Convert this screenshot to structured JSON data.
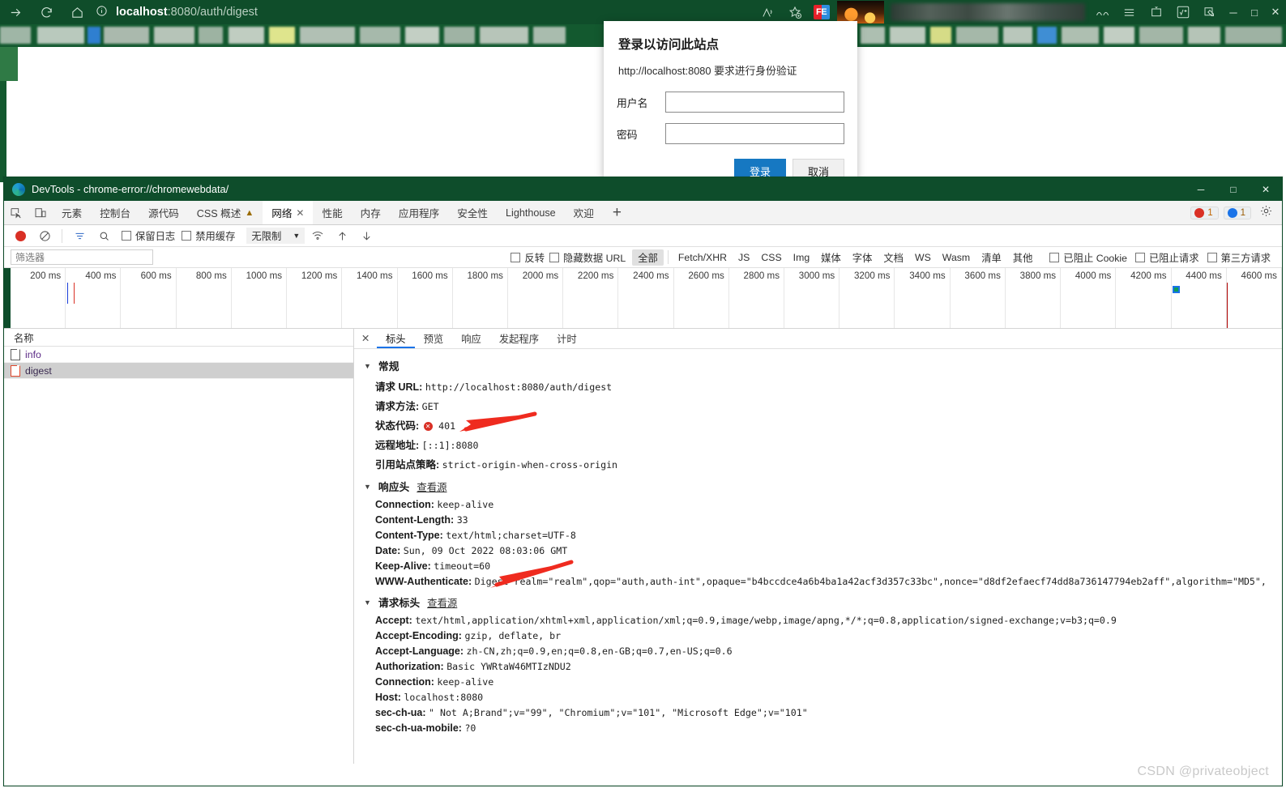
{
  "browser": {
    "url_host": "localhost",
    "url_rest": ":8080/auth/digest",
    "nav_icons": [
      "forward-arrow-icon",
      "reload-icon",
      "home-icon"
    ],
    "info_icon": "info-circle-icon",
    "toolbar_icons": [
      "read-aloud-icon",
      "add-favorite-icon",
      "fe-extension-icon",
      "avatar-icon",
      "collections-icon",
      "browser-essentials-icon",
      "split-screen-icon",
      "math-solver-icon",
      "screenshot-icon"
    ],
    "window_controls": [
      "minimize",
      "maximize",
      "close"
    ]
  },
  "login_dialog": {
    "title": "登录以访问此站点",
    "subtitle": "http://localhost:8080 要求进行身份验证",
    "username_label": "用户名",
    "username_value": "",
    "password_label": "密码",
    "password_value": "",
    "submit_label": "登录",
    "cancel_label": "取消"
  },
  "devtools": {
    "window_title": "DevTools - chrome-error://chromewebdata/",
    "logo_icon": "edge-devtools-logo-icon",
    "window_controls": {
      "minimize": "─",
      "maximize": "□",
      "close": "✕"
    },
    "dock_icons": [
      "inspect-element-icon",
      "device-toolbar-icon"
    ],
    "tabs": [
      {
        "label": "元素",
        "active": false,
        "warn": false,
        "closable": false
      },
      {
        "label": "控制台",
        "active": false,
        "warn": false,
        "closable": false
      },
      {
        "label": "源代码",
        "active": false,
        "warn": false,
        "closable": false
      },
      {
        "label": "CSS 概述",
        "active": false,
        "warn": true,
        "closable": false
      },
      {
        "label": "网络",
        "active": true,
        "warn": false,
        "closable": true
      },
      {
        "label": "性能",
        "active": false,
        "warn": false,
        "closable": false
      },
      {
        "label": "内存",
        "active": false,
        "warn": false,
        "closable": false
      },
      {
        "label": "应用程序",
        "active": false,
        "warn": false,
        "closable": false
      },
      {
        "label": "安全性",
        "active": false,
        "warn": false,
        "closable": false
      },
      {
        "label": "Lighthouse",
        "active": false,
        "warn": false,
        "closable": false
      },
      {
        "label": "欢迎",
        "active": false,
        "warn": false,
        "closable": false
      }
    ],
    "more_tabs_label": "+",
    "badges": {
      "errors": "1",
      "messages": "1"
    },
    "settings_icon": "gear-icon",
    "tab_close_glyph": "✕",
    "warn_glyph": "▲",
    "colors": {
      "accent_green": "#0e4d2b",
      "error_red": "#d93025",
      "info_blue": "#1a73e8",
      "primary_blue": "#1678c2"
    }
  },
  "network_toolbar": {
    "record_icon": "record-stop-icon",
    "clear_icon": "clear-network-icon",
    "filter_icon": "filter-icon",
    "search_icon": "search-icon",
    "preserve_log_label": "保留日志",
    "preserve_log_checked": false,
    "disable_cache_label": "禁用缓存",
    "disable_cache_checked": false,
    "throttle_value": "无限制",
    "throttle_caret": "▼",
    "wifi_icon": "network-conditions-icon",
    "import_icon": "import-har-icon",
    "export_icon": "export-har-icon"
  },
  "network_filter": {
    "placeholder": "筛选器",
    "value": "",
    "invert_label": "反转",
    "invert_checked": false,
    "hide_data_urls_label": "隐藏数据 URL",
    "hide_data_urls_checked": false,
    "types": [
      {
        "label": "全部",
        "selected": true
      },
      {
        "label": "Fetch/XHR",
        "selected": false
      },
      {
        "label": "JS",
        "selected": false
      },
      {
        "label": "CSS",
        "selected": false
      },
      {
        "label": "Img",
        "selected": false
      },
      {
        "label": "媒体",
        "selected": false
      },
      {
        "label": "字体",
        "selected": false
      },
      {
        "label": "文档",
        "selected": false
      },
      {
        "label": "WS",
        "selected": false
      },
      {
        "label": "Wasm",
        "selected": false
      },
      {
        "label": "清单",
        "selected": false
      },
      {
        "label": "其他",
        "selected": false
      }
    ],
    "blocked_cookies_label": "已阻止 Cookie",
    "blocked_cookies_checked": false,
    "blocked_requests_label": "已阻止请求",
    "blocked_requests_checked": false,
    "third_party_label": "第三方请求",
    "third_party_checked": false
  },
  "timeline": {
    "ticks": [
      "200 ms",
      "400 ms",
      "600 ms",
      "800 ms",
      "1000 ms",
      "1200 ms",
      "1400 ms",
      "1600 ms",
      "1800 ms",
      "2000 ms",
      "2200 ms",
      "2400 ms",
      "2600 ms",
      "2800 ms",
      "3000 ms",
      "3200 ms",
      "3400 ms",
      "3600 ms",
      "3800 ms",
      "4000 ms",
      "4200 ms",
      "4400 ms",
      "4600 ms"
    ],
    "markers": [
      {
        "name": "dom-content-loaded-line",
        "at_ms": 205,
        "color": "#1a3dd9"
      },
      {
        "name": "load-event-line",
        "at_ms": 228,
        "color": "#d93025"
      },
      {
        "name": "request-block",
        "at_ms": 4215,
        "color": "#1a73e8"
      },
      {
        "name": "load-event-line-2",
        "at_ms": 4400,
        "color": "#b00000"
      }
    ]
  },
  "request_list": {
    "column_header": "名称",
    "rows": [
      {
        "name": "info",
        "status": "ok",
        "selected": false
      },
      {
        "name": "digest",
        "status": "error",
        "selected": true
      }
    ]
  },
  "detail_panel": {
    "close_glyph": "✕",
    "tabs": [
      {
        "label": "标头",
        "active": true
      },
      {
        "label": "预览",
        "active": false
      },
      {
        "label": "响应",
        "active": false
      },
      {
        "label": "发起程序",
        "active": false
      },
      {
        "label": "计时",
        "active": false
      }
    ],
    "general": {
      "title": "常规",
      "rows": [
        {
          "key": "请求 URL:",
          "value": "http://localhost:8080/auth/digest"
        },
        {
          "key": "请求方法:",
          "value": "GET"
        },
        {
          "key": "状态代码:",
          "value": "401",
          "status_error": true
        },
        {
          "key": "远程地址:",
          "value": "[::1]:8080"
        },
        {
          "key": "引用站点策略:",
          "value": "strict-origin-when-cross-origin"
        }
      ]
    },
    "response_headers": {
      "title": "响应头",
      "view_source_label": "查看源",
      "rows": [
        {
          "key": "Connection:",
          "value": "keep-alive"
        },
        {
          "key": "Content-Length:",
          "value": "33"
        },
        {
          "key": "Content-Type:",
          "value": "text/html;charset=UTF-8"
        },
        {
          "key": "Date:",
          "value": "Sun, 09 Oct 2022 08:03:06 GMT"
        },
        {
          "key": "Keep-Alive:",
          "value": "timeout=60"
        },
        {
          "key": "WWW-Authenticate:",
          "value": "Digest realm=\"realm\",qop=\"auth,auth-int\",opaque=\"b4bccdce4a6b4ba1a42acf3d357c33bc\",nonce=\"d8df2efaecf74dd8a736147794eb2aff\",algorithm=\"MD5\","
        }
      ]
    },
    "request_headers": {
      "title": "请求标头",
      "view_source_label": "查看源",
      "rows": [
        {
          "key": "Accept:",
          "value": "text/html,application/xhtml+xml,application/xml;q=0.9,image/webp,image/apng,*/*;q=0.8,application/signed-exchange;v=b3;q=0.9"
        },
        {
          "key": "Accept-Encoding:",
          "value": "gzip, deflate, br"
        },
        {
          "key": "Accept-Language:",
          "value": "zh-CN,zh;q=0.9,en;q=0.8,en-GB;q=0.7,en-US;q=0.6"
        },
        {
          "key": "Authorization:",
          "value": "Basic YWRtaW46MTIzNDU2"
        },
        {
          "key": "Connection:",
          "value": "keep-alive"
        },
        {
          "key": "Host:",
          "value": "localhost:8080"
        },
        {
          "key": "sec-ch-ua:",
          "value": "\" Not A;Brand\";v=\"99\", \"Chromium\";v=\"101\", \"Microsoft Edge\";v=\"101\""
        },
        {
          "key": "sec-ch-ua-mobile:",
          "value": "?0"
        }
      ]
    }
  },
  "watermark": "CSDN @privateobject"
}
